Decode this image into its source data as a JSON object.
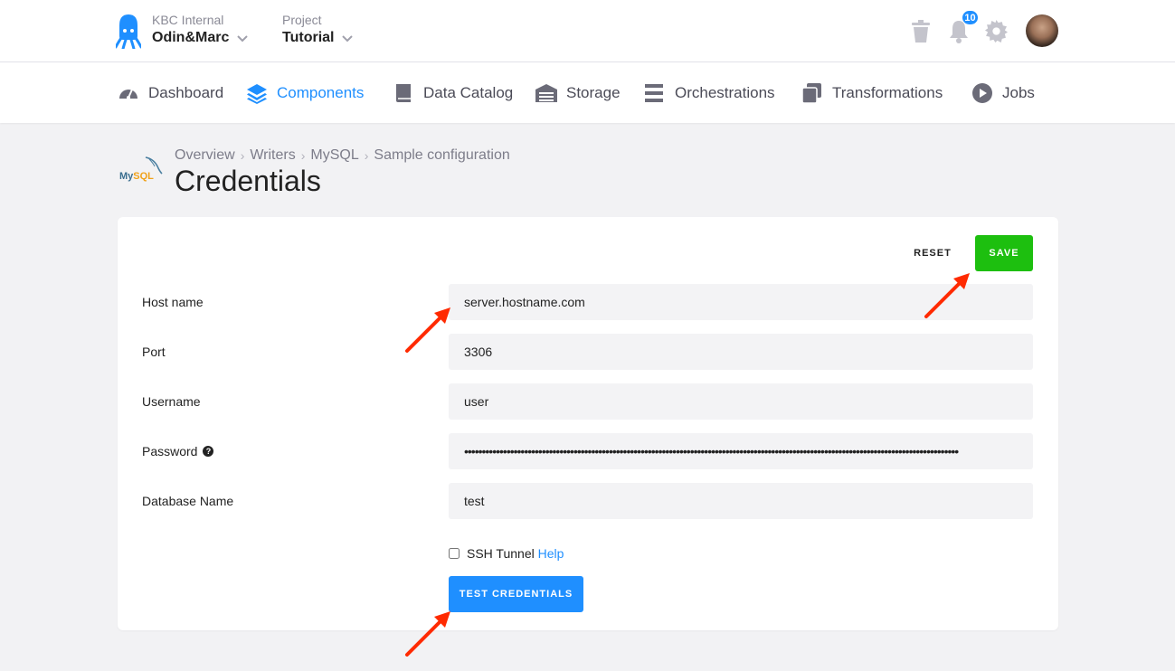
{
  "header": {
    "org_label": "KBC Internal",
    "org_name": "Odin&Marc",
    "project_label": "Project",
    "project_name": "Tutorial",
    "notifications_count": "10"
  },
  "nav": {
    "items": [
      {
        "label": "Dashboard",
        "icon": "gauge-icon"
      },
      {
        "label": "Components",
        "icon": "layers-icon",
        "active": true
      },
      {
        "label": "Data Catalog",
        "icon": "book-icon"
      },
      {
        "label": "Storage",
        "icon": "warehouse-icon"
      },
      {
        "label": "Orchestrations",
        "icon": "bars-icon"
      },
      {
        "label": "Transformations",
        "icon": "copy-icon"
      },
      {
        "label": "Jobs",
        "icon": "play-circle-icon"
      }
    ]
  },
  "breadcrumb": [
    "Overview",
    "Writers",
    "MySQL",
    "Sample configuration"
  ],
  "page": {
    "title": "Credentials",
    "logo_text": "MySQL"
  },
  "actions": {
    "reset": "RESET",
    "save": "SAVE"
  },
  "form": {
    "host_label": "Host name",
    "host_value": "server.hostname.com",
    "port_label": "Port",
    "port_value": "3306",
    "username_label": "Username",
    "username_value": "user",
    "password_label": "Password",
    "password_value": "••••••••••••••••••••••••••••••••••••••••••••••••••••••••••••••••••••••••••••••••••••••••••••••••••••••••••••••••••••••••••••••••••••••••••••",
    "database_label": "Database Name",
    "database_value": "test",
    "ssh_label": "SSH Tunnel",
    "ssh_help": "Help",
    "test_button": "TEST CREDENTIALS"
  },
  "colors": {
    "accent": "#1f8fff",
    "save": "#1dbf0f",
    "arrow": "#ff2a00"
  }
}
